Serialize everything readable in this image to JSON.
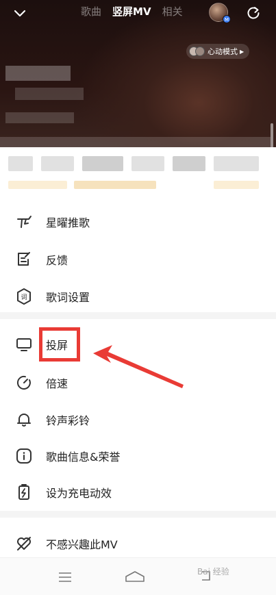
{
  "top_nav": {
    "tabs": [
      {
        "label": "歌曲",
        "active": false
      },
      {
        "label": "竖屏MV",
        "active": true
      },
      {
        "label": "相关",
        "active": false
      }
    ],
    "avatar_badge": "M",
    "heart_mode_label": "心动模式"
  },
  "menu": {
    "group1": [
      {
        "label": "星曜推歌",
        "icon": "star-recommend-icon"
      },
      {
        "label": "反馈",
        "icon": "feedback-icon"
      },
      {
        "label": "歌词设置",
        "icon": "lyrics-settings-icon"
      }
    ],
    "group2": [
      {
        "label": "投屏",
        "icon": "cast-screen-icon"
      },
      {
        "label": "倍速",
        "icon": "playback-speed-icon"
      },
      {
        "label": "铃声彩铃",
        "icon": "ringtone-bell-icon"
      },
      {
        "label": "歌曲信息&荣誉",
        "icon": "info-icon"
      },
      {
        "label": "设为充电动效",
        "icon": "charging-effect-icon"
      }
    ],
    "group3": [
      {
        "label": "不感兴趣此MV",
        "icon": "not-interested-icon"
      }
    ]
  },
  "annotation": {
    "highlight_color": "#e93b35"
  },
  "watermark": "Bai 经验",
  "colors": {
    "header_bg": "#1c0f0e",
    "accent_red": "#e93b35",
    "menu_text": "#222222"
  }
}
